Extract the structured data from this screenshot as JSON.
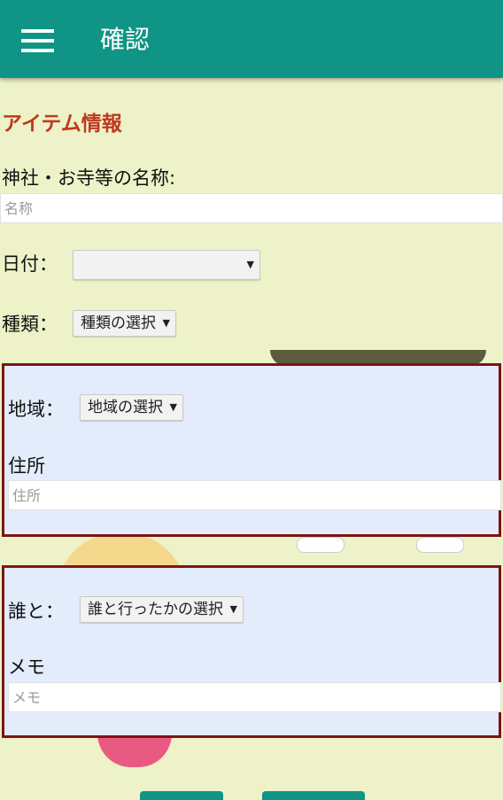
{
  "appbar": {
    "title": "確認"
  },
  "section": {
    "heading": "アイテム情報"
  },
  "name_field": {
    "label": "神社・お寺等の名称:",
    "placeholder": "名称"
  },
  "date_field": {
    "label": "日付：",
    "value": ""
  },
  "type_field": {
    "label": "種類：",
    "value": "種類の選択"
  },
  "region_box": {
    "region_label": "地域：",
    "region_value": "地域の選択",
    "address_label": "住所",
    "address_placeholder": "住所"
  },
  "companion_box": {
    "who_label": "誰と：",
    "who_value": "誰と行ったかの選択",
    "memo_label": "メモ",
    "memo_placeholder": "メモ"
  },
  "colors": {
    "appbar": "#0f9485",
    "background": "#edf2c8",
    "heading": "#c0391d",
    "box_border": "#7d1417",
    "box_fill": "#e3ecfb"
  },
  "icons": {
    "menu": "hamburger-menu-icon",
    "select_arrow": "triangle-down"
  }
}
